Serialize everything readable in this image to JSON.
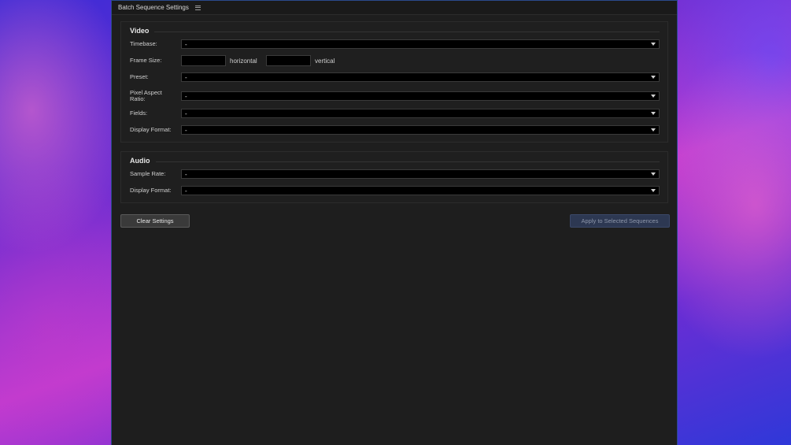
{
  "panel": {
    "title": "Batch Sequence Settings"
  },
  "video": {
    "title": "Video",
    "timebase": {
      "label": "Timebase:",
      "value": "-"
    },
    "frame_size": {
      "label": "Frame Size:",
      "horizontal_value": "",
      "horizontal_unit": "horizontal",
      "vertical_value": "",
      "vertical_unit": "vertical"
    },
    "preset": {
      "label": "Preset:",
      "value": "-"
    },
    "pixel_aspect_ratio": {
      "label": "Pixel Aspect Ratio:",
      "value": "-"
    },
    "fields": {
      "label": "Fields:",
      "value": "-"
    },
    "display_format": {
      "label": "Display Format:",
      "value": "-"
    }
  },
  "audio": {
    "title": "Audio",
    "sample_rate": {
      "label": "Sample Rate:",
      "value": "-"
    },
    "display_format": {
      "label": "Display Format:",
      "value": "-"
    }
  },
  "buttons": {
    "clear": "Clear Settings",
    "apply": "Apply to Selected Sequences"
  }
}
